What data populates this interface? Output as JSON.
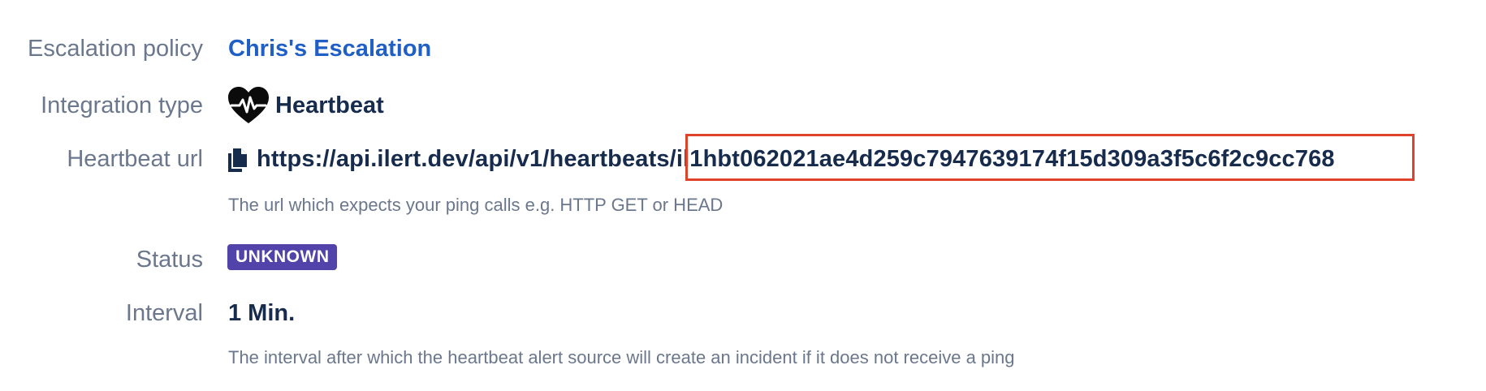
{
  "escalation_policy": {
    "label": "Escalation policy",
    "value": "Chris's Escalation"
  },
  "integration_type": {
    "label": "Integration type",
    "icon": "heartbeat-icon",
    "value": "Heartbeat"
  },
  "heartbeat_url": {
    "label": "Heartbeat url",
    "icon": "copy-icon",
    "value": "https://api.ilert.dev/api/v1/heartbeats/il1hbt062021ae4d259c7947639174f15d309a3f5c6f2c9cc768",
    "help": "The url which expects your ping calls e.g. HTTP GET or HEAD"
  },
  "status": {
    "label": "Status",
    "badge": "UNKNOWN",
    "badge_color": "#5243aa"
  },
  "interval": {
    "label": "Interval",
    "value": "1 Min.",
    "help": "The interval after which the heartbeat alert source will create an incident if it does not receive a ping"
  },
  "colors": {
    "label": "#6b778c",
    "text": "#172b4d",
    "link": "#1f5fc6",
    "highlight": "#e0432c"
  }
}
